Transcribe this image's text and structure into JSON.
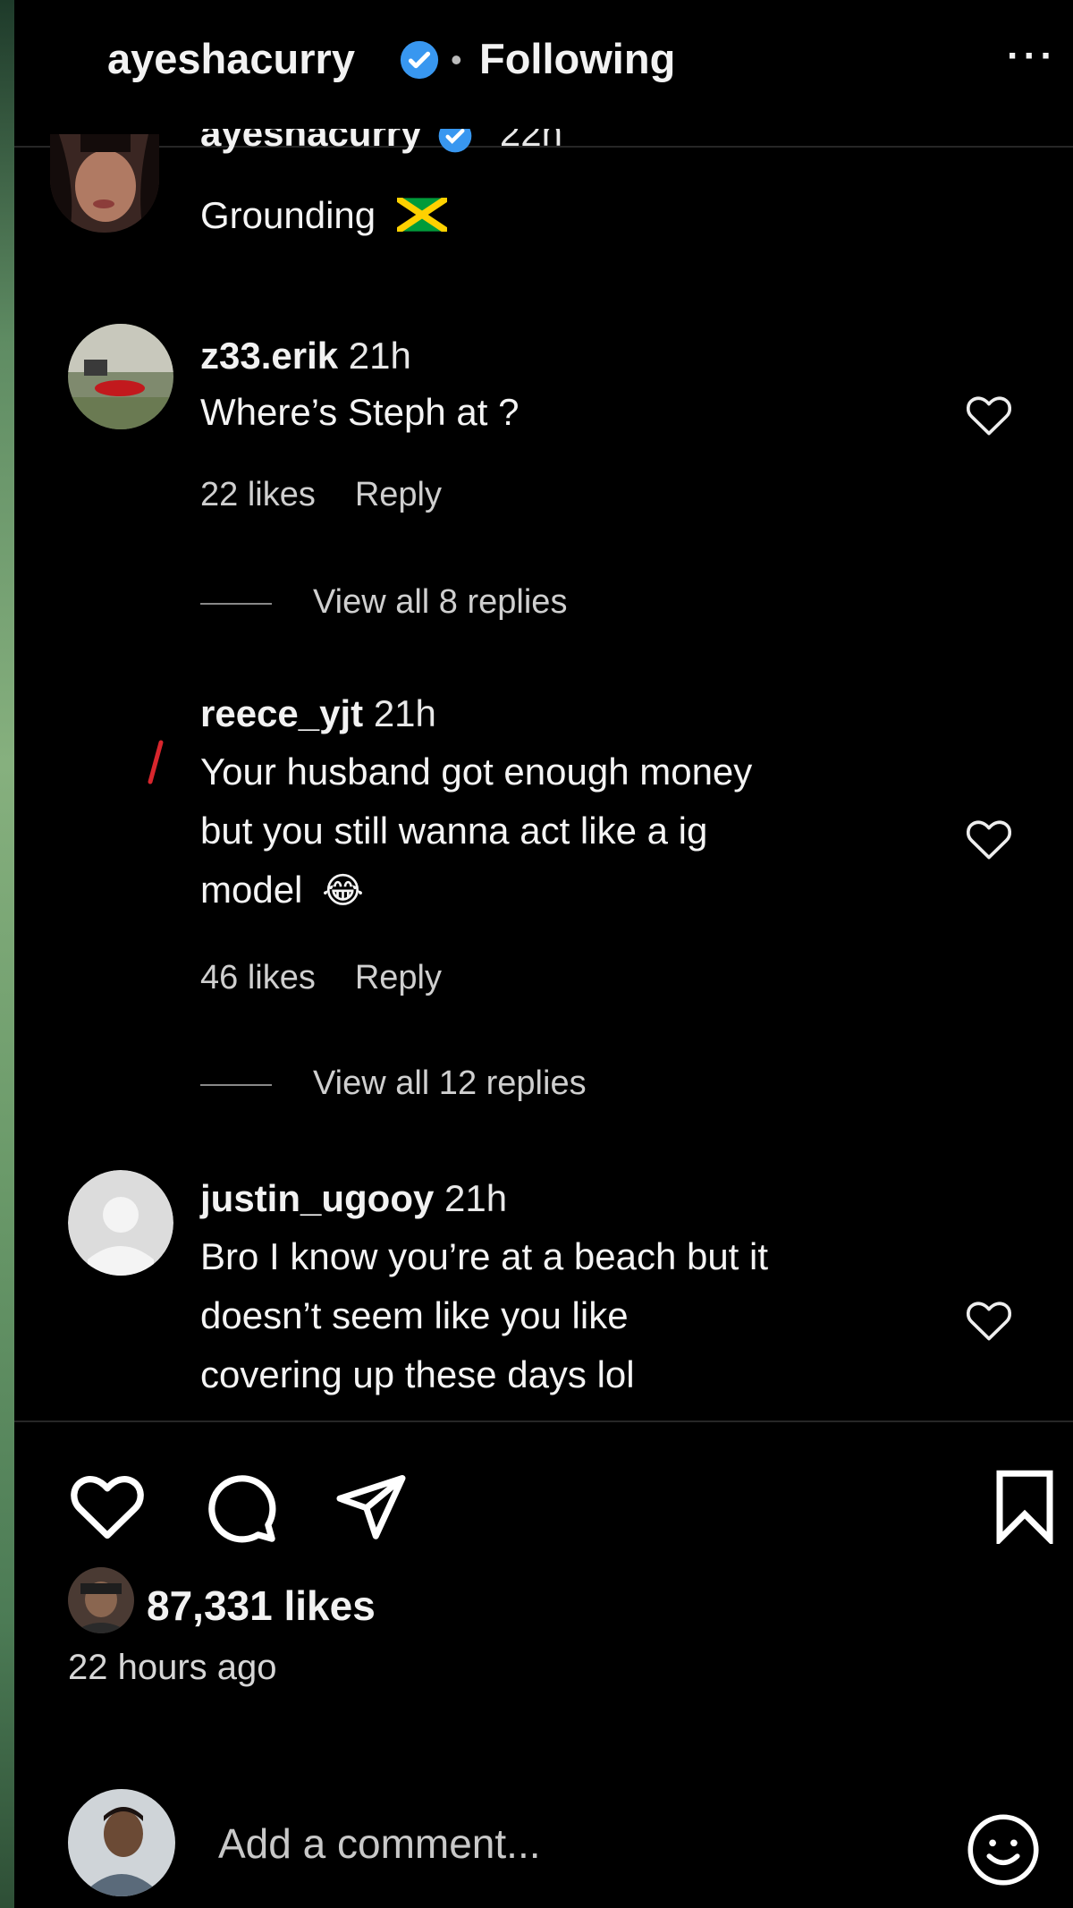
{
  "header": {
    "username": "ayeshacurry",
    "separator": "•",
    "follow_status": "Following",
    "more": "···"
  },
  "caption": {
    "username": "ayeshacurry",
    "time": "22h",
    "text": "Grounding",
    "flag_icon": "jamaica-flag-icon"
  },
  "comments": [
    {
      "username": "z33.erik",
      "time": "21h",
      "lines": [
        "Where’s Steph at ?"
      ],
      "likes": "22 likes",
      "reply": "Reply",
      "view_replies": "View all 8 replies"
    },
    {
      "username": "reece_yjt",
      "time": "21h",
      "lines": [
        "Your husband got enough money",
        "but you still wanna act like a ig",
        "model"
      ],
      "emoji": "😂",
      "likes": "46 likes",
      "reply": "Reply",
      "view_replies": "View all 12 replies"
    },
    {
      "username": "justin_ugooy",
      "time": "21h",
      "lines": [
        "Bro I know you’re at a beach but it",
        "doesn’t seem like you like",
        "covering up these days lol"
      ]
    }
  ],
  "post_actions": {
    "like_icon": "heart-icon",
    "comment_icon": "comment-icon",
    "share_icon": "share-icon",
    "save_icon": "bookmark-icon"
  },
  "stats": {
    "likes": "87,331 likes",
    "posted": "22 hours ago"
  },
  "comment_box": {
    "placeholder": "Add a comment...",
    "emoji_icon": "smiley-icon"
  },
  "colors": {
    "background": "#000000",
    "verified_blue": "#3897f0",
    "text": "#f2f2f2",
    "muted": "#cfcfcf"
  }
}
